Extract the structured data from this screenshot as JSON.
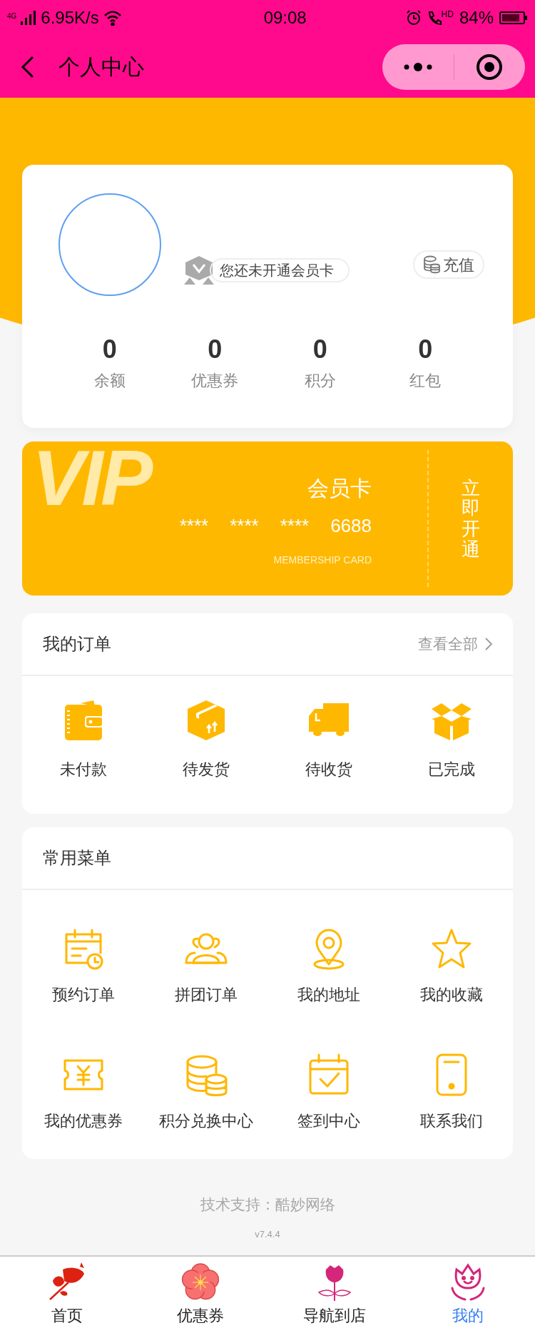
{
  "status_bar": {
    "network": "4G",
    "speed": "6.95K/s",
    "time": "09:08",
    "call_label": "HD",
    "battery": "84%"
  },
  "nav": {
    "title": "个人中心"
  },
  "profile": {
    "member_status": "您还未开通会员卡",
    "recharge": "充值",
    "stats": [
      {
        "value": "0",
        "label": "余额"
      },
      {
        "value": "0",
        "label": "优惠券"
      },
      {
        "value": "0",
        "label": "积分"
      },
      {
        "value": "0",
        "label": "红包"
      }
    ]
  },
  "vip_card": {
    "watermark": "VIP",
    "title": "会员卡",
    "number_groups": [
      "****",
      "****",
      "****",
      "6688"
    ],
    "subtitle": "MEMBERSHIP CARD",
    "action": "立即开通"
  },
  "orders": {
    "title": "我的订单",
    "view_all": "查看全部",
    "items": [
      {
        "label": "未付款"
      },
      {
        "label": "待发货"
      },
      {
        "label": "待收货"
      },
      {
        "label": "已完成"
      }
    ]
  },
  "menu": {
    "title": "常用菜单",
    "items": [
      {
        "label": "预约订单"
      },
      {
        "label": "拼团订单"
      },
      {
        "label": "我的地址"
      },
      {
        "label": "我的收藏"
      },
      {
        "label": "我的优惠券"
      },
      {
        "label": "积分兑换中心"
      },
      {
        "label": "签到中心"
      },
      {
        "label": "联系我们"
      }
    ]
  },
  "footer": {
    "support": "技术支持：酷妙网络",
    "version": "v7.4.4"
  },
  "tab_bar": [
    {
      "label": "首页",
      "selected": false
    },
    {
      "label": "优惠券",
      "selected": false
    },
    {
      "label": "导航到店",
      "selected": false
    },
    {
      "label": "我的",
      "selected": true
    }
  ]
}
